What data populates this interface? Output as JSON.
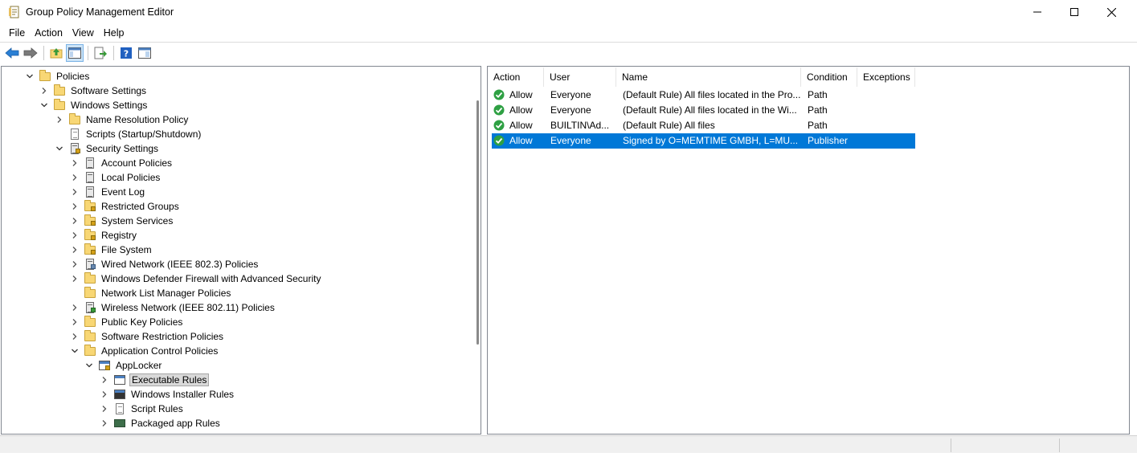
{
  "window": {
    "title": "Group Policy Management Editor",
    "app_icon": "gpo-editor-icon",
    "controls": [
      "minimize-icon",
      "maximize-icon",
      "close-icon"
    ]
  },
  "menu": {
    "items": [
      "File",
      "Action",
      "View",
      "Help"
    ]
  },
  "toolbar": {
    "buttons": [
      "back-arrow-icon",
      "forward-arrow-icon",
      "up-folder-icon",
      "show-hide-tree-icon",
      "export-list-icon",
      "help-icon",
      "properties-icon"
    ]
  },
  "tree": {
    "nodes": [
      {
        "label": "Policies",
        "expanded": true,
        "icon": "folder-icon"
      },
      {
        "label": "Software Settings",
        "expanded": false,
        "icon": "folder-icon"
      },
      {
        "label": "Windows Settings",
        "expanded": true,
        "icon": "folder-icon"
      },
      {
        "label": "Name Resolution Policy",
        "expanded": false,
        "icon": "folder-icon"
      },
      {
        "label": "Scripts (Startup/Shutdown)",
        "icon": "script-doc-icon"
      },
      {
        "label": "Security Settings",
        "expanded": true,
        "icon": "security-settings-icon"
      },
      {
        "label": "Account Policies",
        "expanded": false,
        "icon": "server-doc-icon"
      },
      {
        "label": "Local Policies",
        "expanded": false,
        "icon": "server-doc-icon"
      },
      {
        "label": "Event Log",
        "expanded": false,
        "icon": "server-doc-icon"
      },
      {
        "label": "Restricted Groups",
        "expanded": false,
        "icon": "locked-folder-icon"
      },
      {
        "label": "System Services",
        "expanded": false,
        "icon": "locked-folder-icon"
      },
      {
        "label": "Registry",
        "expanded": false,
        "icon": "locked-folder-icon"
      },
      {
        "label": "File System",
        "expanded": false,
        "icon": "locked-folder-icon"
      },
      {
        "label": "Wired Network (IEEE 802.3) Policies",
        "expanded": false,
        "icon": "wired-network-icon"
      },
      {
        "label": "Windows Defender Firewall with Advanced Security",
        "expanded": false,
        "icon": "folder-icon"
      },
      {
        "label": "Network List Manager Policies",
        "icon": "folder-icon"
      },
      {
        "label": "Wireless Network (IEEE 802.11) Policies",
        "expanded": false,
        "icon": "wireless-network-icon"
      },
      {
        "label": "Public Key Policies",
        "expanded": false,
        "icon": "folder-icon"
      },
      {
        "label": "Software Restriction Policies",
        "expanded": false,
        "icon": "folder-icon"
      },
      {
        "label": "Application Control Policies",
        "expanded": true,
        "icon": "folder-icon"
      },
      {
        "label": "AppLocker",
        "expanded": true,
        "icon": "applocker-icon"
      },
      {
        "label": "Executable Rules",
        "expanded": false,
        "icon": "executable-rules-icon",
        "selected": true
      },
      {
        "label": "Windows Installer Rules",
        "expanded": false,
        "icon": "installer-rules-icon"
      },
      {
        "label": "Script Rules",
        "expanded": false,
        "icon": "script-rules-icon"
      },
      {
        "label": "Packaged app Rules",
        "expanded": false,
        "icon": "packaged-app-icon"
      }
    ]
  },
  "list": {
    "columns": [
      "Action",
      "User",
      "Name",
      "Condition",
      "Exceptions"
    ],
    "rows": [
      {
        "action": "Allow",
        "user": "Everyone",
        "name": "(Default Rule) All files located in the Pro...",
        "condition": "Path",
        "exceptions": "",
        "selected": false
      },
      {
        "action": "Allow",
        "user": "Everyone",
        "name": "(Default Rule) All files located in the Wi...",
        "condition": "Path",
        "exceptions": "",
        "selected": false
      },
      {
        "action": "Allow",
        "user": "BUILTIN\\Ad...",
        "name": "(Default Rule) All files",
        "condition": "Path",
        "exceptions": "",
        "selected": false
      },
      {
        "action": "Allow",
        "user": "Everyone",
        "name": "Signed by O=MEMTIME GMBH, L=MU...",
        "condition": "Publisher",
        "exceptions": "",
        "selected": true
      }
    ]
  },
  "colors": {
    "selection": "#0078d7",
    "allow_check": "#2ea043",
    "folder": "#f8d775"
  }
}
